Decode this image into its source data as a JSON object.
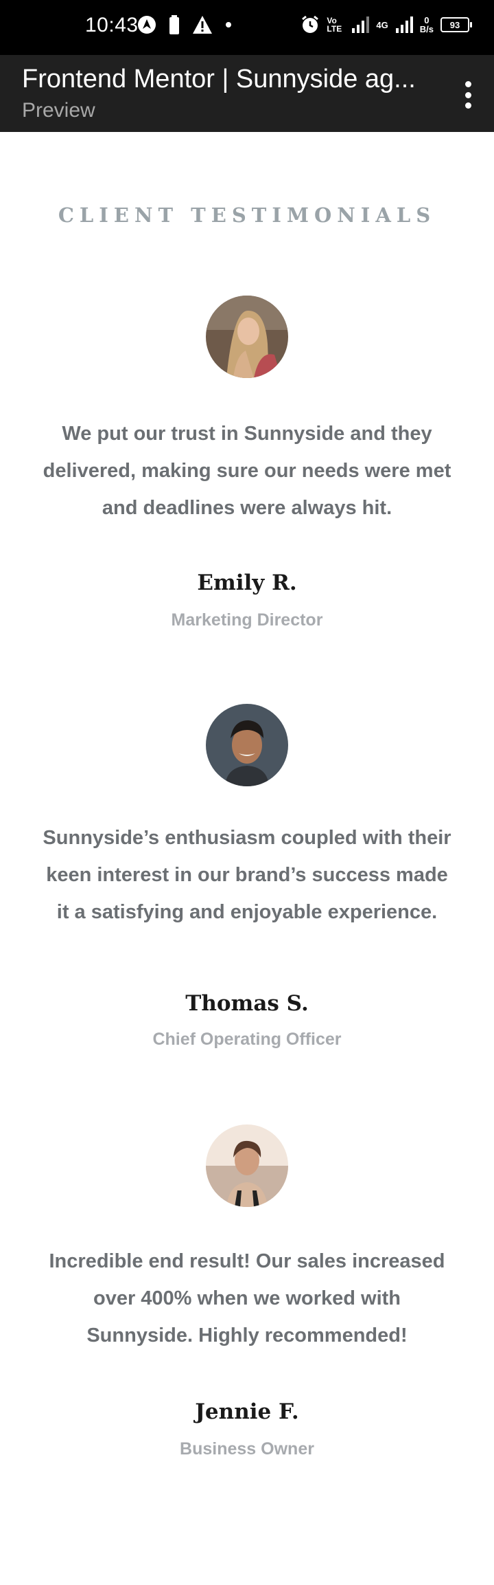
{
  "status_bar": {
    "time": "10:43",
    "network": "4G",
    "volte": "Vo LTE",
    "speed_value": "0",
    "speed_unit": "B/s",
    "battery": "93"
  },
  "app_bar": {
    "title": "Frontend Mentor | Sunnyside ag...",
    "subtitle": "Preview"
  },
  "section": {
    "heading": "CLIENT TESTIMONIALS"
  },
  "testimonials": [
    {
      "quote": "We put our trust in Sunnyside and they delivered, making sure our needs were met and deadlines were always hit.",
      "name": "Emily R.",
      "role": "Marketing Director"
    },
    {
      "quote": "Sunnyside’s enthusiasm coupled with their keen interest in our brand’s success made it a satisfying and enjoyable experience.",
      "name": "Thomas S.",
      "role": "Chief Operating Officer"
    },
    {
      "quote": "Incredible end result! Our sales increased over 400% when we worked with Sunnyside. Highly recommended!",
      "name": "Jennie F.",
      "role": "Business Owner"
    }
  ]
}
